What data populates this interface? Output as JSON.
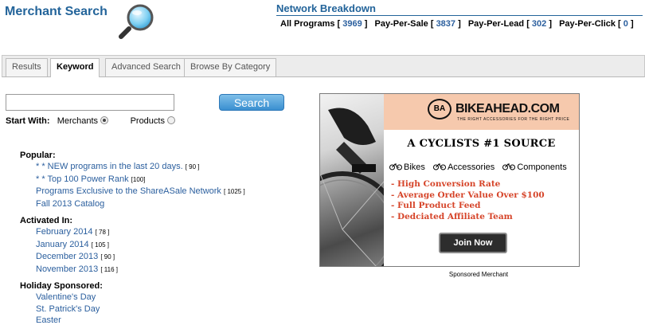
{
  "header": {
    "title": "Merchant Search",
    "network_title": "Network Breakdown",
    "stats": [
      {
        "label": "All Programs",
        "count": "3969"
      },
      {
        "label": "Pay-Per-Sale",
        "count": "3837"
      },
      {
        "label": "Pay-Per-Lead",
        "count": "302"
      },
      {
        "label": "Pay-Per-Click",
        "count": "0"
      }
    ]
  },
  "tabs": [
    {
      "label": "Results",
      "active": false
    },
    {
      "label": "Keyword",
      "active": true
    },
    {
      "label": "Advanced Search",
      "active": false
    },
    {
      "label": "Browse By Category",
      "active": false
    }
  ],
  "search": {
    "value": "",
    "button_label": "Search",
    "start_with_label": "Start With:",
    "options": [
      {
        "label": "Merchants",
        "checked": true
      },
      {
        "label": "Products",
        "checked": false
      }
    ]
  },
  "popular": {
    "heading": "Popular:",
    "items": [
      {
        "text": "* * NEW programs in the last 20 days.",
        "count": "[ 90 ]"
      },
      {
        "text": "* * Top 100 Power Rank",
        "count": "[100]"
      },
      {
        "text": "Programs Exclusive to the ShareASale Network",
        "count": "[ 1025 ]"
      },
      {
        "text": "Fall 2013 Catalog",
        "count": ""
      }
    ]
  },
  "activated": {
    "heading": "Activated In:",
    "items": [
      {
        "text": "February 2014",
        "count": "[ 78 ]"
      },
      {
        "text": "January 2014",
        "count": "[ 105 ]"
      },
      {
        "text": "December 2013",
        "count": "[ 90 ]"
      },
      {
        "text": "November 2013",
        "count": "[ 116 ]"
      }
    ]
  },
  "holiday": {
    "heading": "Holiday Sponsored:",
    "items": [
      {
        "text": "Valentine's Day",
        "count": ""
      },
      {
        "text": "St. Patrick's Day",
        "count": ""
      },
      {
        "text": "Easter",
        "count": ""
      }
    ]
  },
  "ad": {
    "logo_badge": "BA",
    "logo_text": "BIKEAHEAD.COM",
    "logo_sub": "THE RIGHT ACCESSORIES FOR THE RIGHT PRICE",
    "headline": "A CYCLISTS #1 SOURCE",
    "categories": [
      "Bikes",
      "Accessories",
      "Components"
    ],
    "bullets": [
      "- High Conversion Rate",
      "- Average Order Value Over $100",
      "- Full Product Feed",
      "- Dedciated Affiliate Team"
    ],
    "button_label": "Join Now",
    "caption": "Sponsored Merchant",
    "colors": {
      "header_bg": "#f6c9ad",
      "bullet_text": "#d6452a"
    }
  },
  "colors": {
    "brand_blue": "#23649a",
    "link_blue": "#2b5f9e"
  }
}
